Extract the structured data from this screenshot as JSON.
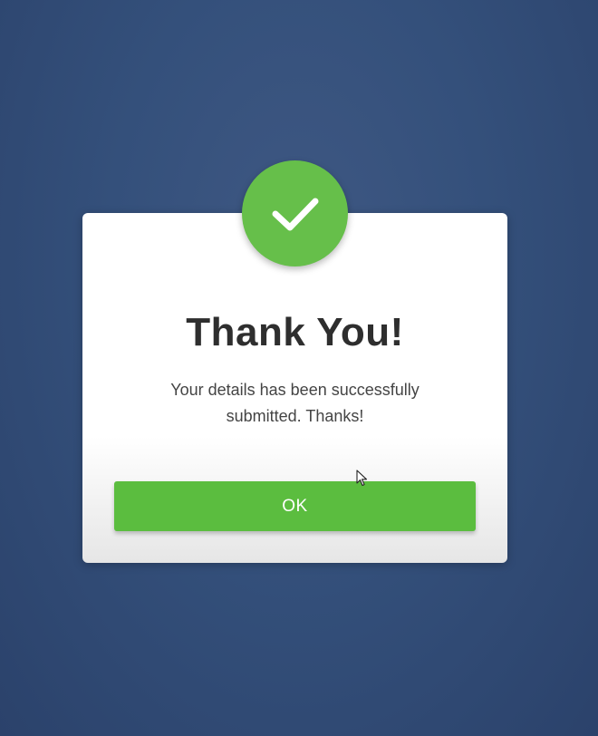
{
  "popup": {
    "title": "Thank You!",
    "message": "Your details has been successfully submitted. Thanks!",
    "ok_label": "OK"
  },
  "icons": {
    "badge": "checkmark-icon",
    "pointer": "mouse-cursor-icon"
  },
  "colors": {
    "background": "#34507b",
    "accent_green": "#5bbd3f",
    "badge_green": "#66bf4a",
    "title_text": "#2e2e2e",
    "body_text": "#444444"
  }
}
